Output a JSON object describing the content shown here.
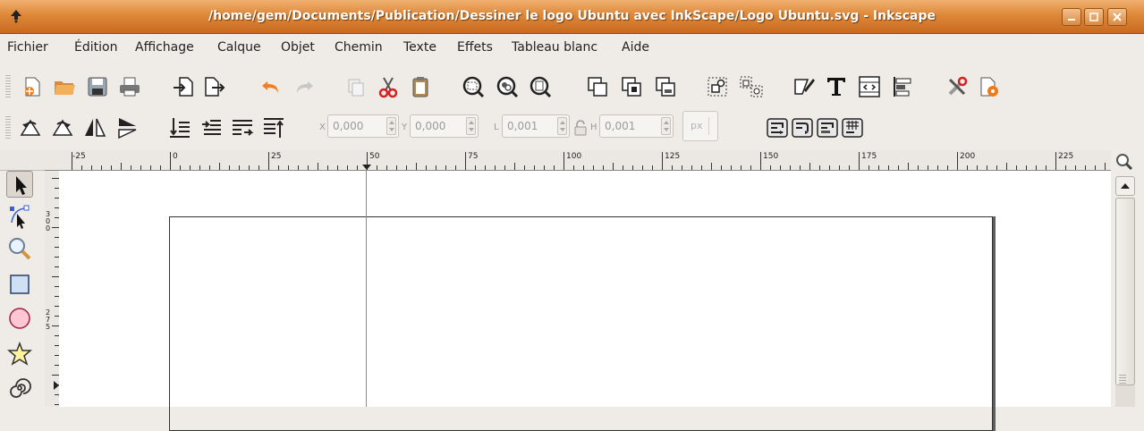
{
  "window": {
    "title": "/home/gem/Documents/Publication/Dessiner le logo Ubuntu avec InkScape/Logo Ubuntu.svg - Inkscape"
  },
  "menu": [
    {
      "label": "Fichier"
    },
    {
      "label": "Édition"
    },
    {
      "label": "Affichage"
    },
    {
      "label": "Calque"
    },
    {
      "label": "Objet"
    },
    {
      "label": "Chemin"
    },
    {
      "label": "Texte"
    },
    {
      "label": "Effets"
    },
    {
      "label": "Tableau blanc"
    },
    {
      "label": "Aide"
    }
  ],
  "toolbar_select": {
    "x_label": "X",
    "x_value": "0,000",
    "y_label": "Y",
    "y_value": "0,000",
    "w_label": "L",
    "w_value": "0,001",
    "h_label": "H",
    "h_value": "0,001",
    "unit": "px"
  },
  "ruler": {
    "h_labels": [
      "-25",
      "0",
      "25",
      "50",
      "75",
      "100",
      "125",
      "150",
      "175",
      "200",
      "225"
    ],
    "v_labels": [
      [
        "3",
        "0",
        "0"
      ],
      [
        "2",
        "7",
        "5"
      ]
    ]
  },
  "colors": {
    "titlebar": "#de8838",
    "guide": "#e86a52",
    "canvas": "#ffffff"
  }
}
